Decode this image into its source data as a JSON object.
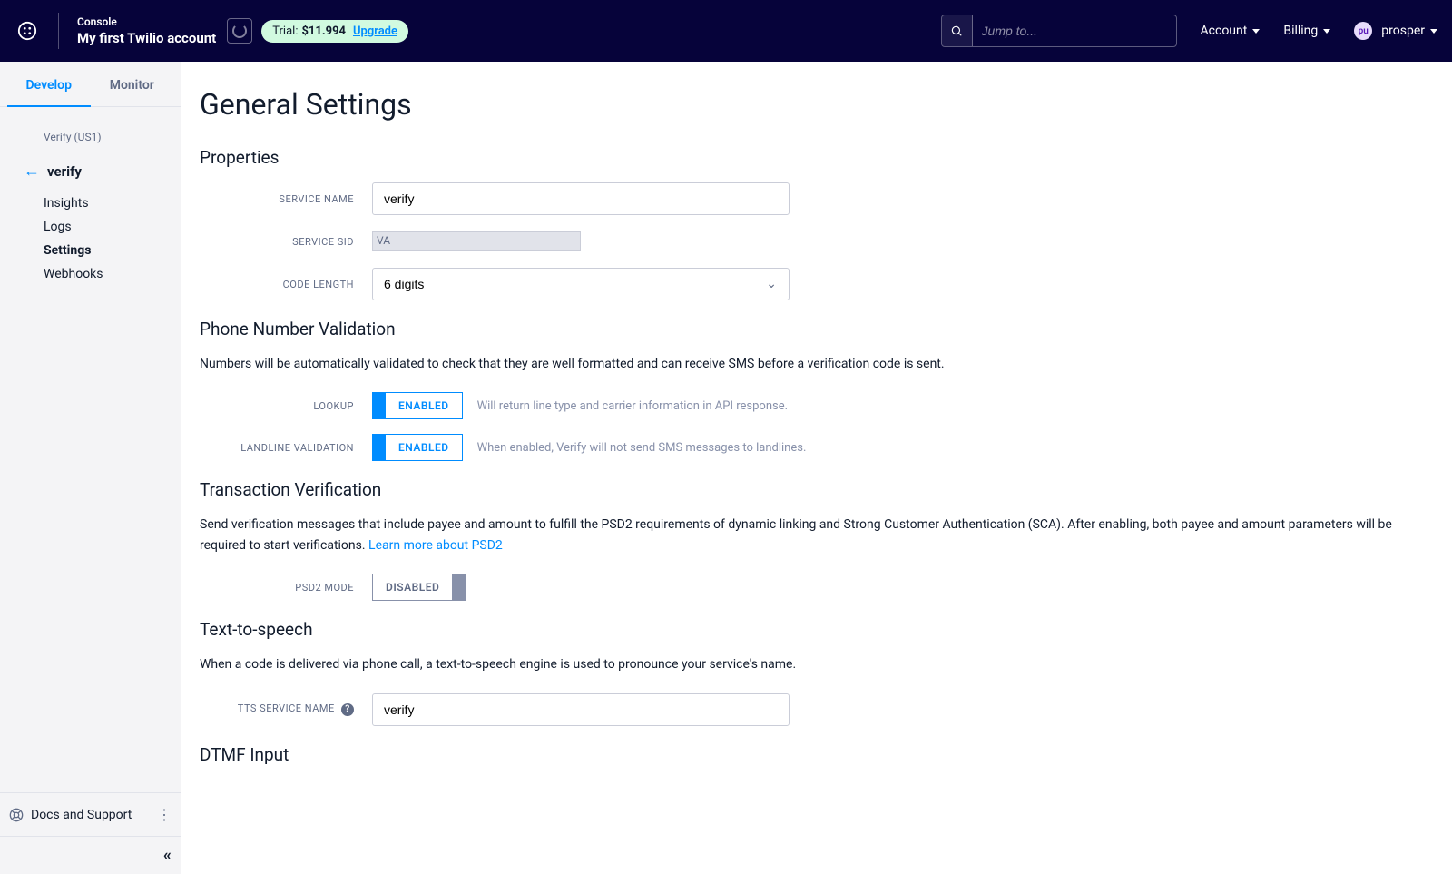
{
  "header": {
    "console_label": "Console",
    "account_name": "My first Twilio account",
    "trial_label": "Trial:",
    "trial_amount": "$11.994",
    "upgrade_label": "Upgrade",
    "search_placeholder": "Jump to...",
    "nav_account": "Account",
    "nav_billing": "Billing",
    "avatar_initials": "pu",
    "nav_user": "prosper"
  },
  "sidebar": {
    "tab_develop": "Develop",
    "tab_monitor": "Monitor",
    "region_label": "Verify (US1)",
    "service_name": "verify",
    "links": {
      "insights": "Insights",
      "logs": "Logs",
      "settings": "Settings",
      "webhooks": "Webhooks"
    },
    "docs_label": "Docs and Support"
  },
  "page": {
    "title": "General Settings",
    "sections": {
      "properties": {
        "heading": "Properties",
        "service_name_label": "Service Name",
        "service_name_value": "verify",
        "service_sid_label": "Service SID",
        "service_sid_value": "VA",
        "code_length_label": "Code Length",
        "code_length_value": "6 digits"
      },
      "phone_validation": {
        "heading": "Phone Number Validation",
        "desc": "Numbers will be automatically validated to check that they are well formatted and can receive SMS before a verification code is sent.",
        "lookup_label": "Lookup",
        "lookup_state": "ENABLED",
        "lookup_hint": "Will return line type and carrier information in API response.",
        "landline_label": "Landline Validation",
        "landline_state": "ENABLED",
        "landline_hint": "When enabled, Verify will not send SMS messages to landlines."
      },
      "transaction": {
        "heading": "Transaction Verification",
        "desc_part1": "Send verification messages that include payee and amount to fulfill the PSD2 requirements of dynamic linking and Strong Customer Authentication (SCA). After enabling, both payee and amount parameters will be required to start verifications. ",
        "desc_link": "Learn more about PSD2",
        "psd2_label": "PSD2 Mode",
        "psd2_state": "DISABLED"
      },
      "tts": {
        "heading": "Text-to-speech",
        "desc": "When a code is delivered via phone call, a text-to-speech engine is used to pronounce your service's name.",
        "tts_label": "TTS Service Name",
        "tts_value": "verify"
      },
      "dtmf": {
        "heading": "DTMF Input"
      }
    }
  }
}
